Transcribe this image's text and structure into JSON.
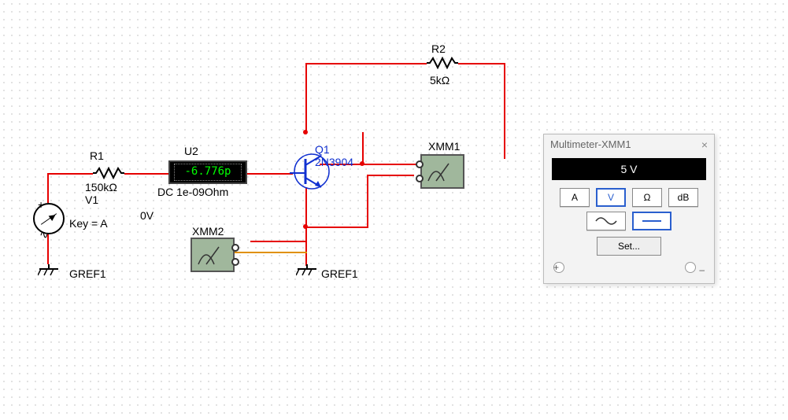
{
  "components": {
    "R1": {
      "ref": "R1",
      "value": "150kΩ"
    },
    "R2": {
      "ref": "R2",
      "value": "5kΩ"
    },
    "V1": {
      "ref": "V1",
      "key": "Key = A",
      "volt": "0V"
    },
    "U2": {
      "ref": "U2",
      "reading": "-6.776p",
      "mode": "DC  1e-09Ohm"
    },
    "Q1": {
      "ref": "Q1",
      "part": "2N3904"
    },
    "XMM1": {
      "ref": "XMM1"
    },
    "XMM2": {
      "ref": "XMM2"
    },
    "GREF_left": "GREF1",
    "GREF_right": "GREF1"
  },
  "multimeter_window": {
    "title": "Multimeter-XMM1",
    "reading": "5 V",
    "buttons": {
      "A": "A",
      "V": "V",
      "Ohm": "Ω",
      "dB": "dB"
    },
    "selected_mode": "V",
    "wave_ac": "∿",
    "wave_dc": "—",
    "selected_wave": "dc",
    "set": "Set...",
    "plus": "+",
    "minus": "–"
  }
}
